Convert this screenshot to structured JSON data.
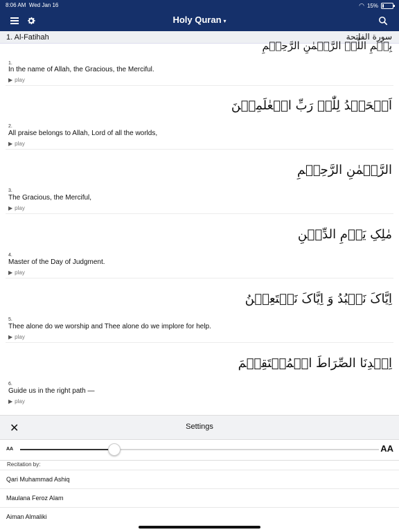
{
  "status": {
    "time": "8:06 AM",
    "date": "Wed Jan 16",
    "battery": "15%",
    "battery_level": 0.15
  },
  "nav": {
    "title": "Holy Quran",
    "caret": "▾"
  },
  "surah": {
    "header": "1.  Al-Fatihah",
    "arabic_name": "سورة الفاتحة",
    "bismillah": "بِسۡمِ اللّٰہِ الرَّحۡمٰنِ الرَّحِیۡمِ"
  },
  "verses": [
    {
      "num": "1.",
      "text": "In the name of Allah, the Gracious, the Merciful.",
      "play": "play"
    },
    {
      "num": "2.",
      "arabic": "اَلۡحَمۡدُ لِلّٰہِ رَبِّ الۡعٰلَمِیۡنَ",
      "text": "All praise belongs to Allah, Lord of all the worlds,",
      "play": "play"
    },
    {
      "num": "3.",
      "arabic": "الرَّحۡمٰنِ الرَّحِیۡمِ",
      "text": "The Gracious, the Merciful,",
      "play": "play"
    },
    {
      "num": "4.",
      "arabic": "مٰلِکِ یَوۡمِ الدِّیۡنِ",
      "text": "Master of the Day of Judgment.",
      "play": "play"
    },
    {
      "num": "5.",
      "arabic": "اِیَّاکَ نَعۡبُدُ وَ اِیَّاکَ نَسۡتَعِیۡنُ",
      "text": "Thee alone do we worship and Thee alone do we implore for help.",
      "play": "play"
    },
    {
      "num": "6.",
      "arabic": "اِہۡدِنَا الصِّرَاطَ الۡمُسۡتَقِیۡمَ",
      "text": "Guide us in the right path —",
      "play": "play"
    }
  ],
  "settings": {
    "title": "Settings",
    "aa_small": "AA",
    "aa_large": "AA",
    "font_size_fraction": 0.26,
    "recitation_label": "Recitation by:",
    "reciters": [
      "Qari Muhammad Ashiq",
      "Maulana Feroz Alam",
      "Aiman Almaliki"
    ]
  }
}
